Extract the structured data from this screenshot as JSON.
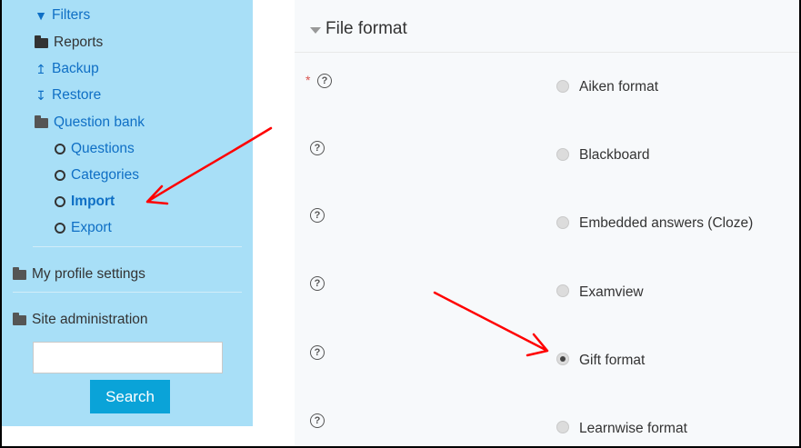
{
  "sidebar": {
    "items": [
      {
        "label": "Filters",
        "icon": "funnel-icon"
      },
      {
        "label": "Reports",
        "icon": "folder-icon"
      },
      {
        "label": "Backup",
        "icon": "upload-icon"
      },
      {
        "label": "Restore",
        "icon": "download-icon"
      },
      {
        "label": "Question bank",
        "icon": "folder-open-icon"
      },
      {
        "label": "Questions",
        "icon": "circle-icon"
      },
      {
        "label": "Categories",
        "icon": "circle-icon"
      },
      {
        "label": "Import",
        "icon": "circle-icon"
      },
      {
        "label": "Export",
        "icon": "circle-icon"
      }
    ],
    "profile_label": "My profile settings",
    "admin_label": "Site administration",
    "search": {
      "value": "",
      "button_label": "Search"
    }
  },
  "main": {
    "section_title": "File format",
    "options": [
      {
        "label": "Aiken format",
        "checked": false
      },
      {
        "label": "Blackboard",
        "checked": false
      },
      {
        "label": "Embedded answers (Cloze)",
        "checked": false
      },
      {
        "label": "Examview",
        "checked": false
      },
      {
        "label": "Gift format",
        "checked": true
      },
      {
        "label": "Learnwise format",
        "checked": false
      }
    ],
    "help_glyph": "?",
    "required_mark": "*"
  },
  "colors": {
    "sidebar_bg": "#a8dff7",
    "link": "#0f6fc5",
    "button": "#0aa3d8",
    "annotation_arrow": "#ff0000"
  }
}
